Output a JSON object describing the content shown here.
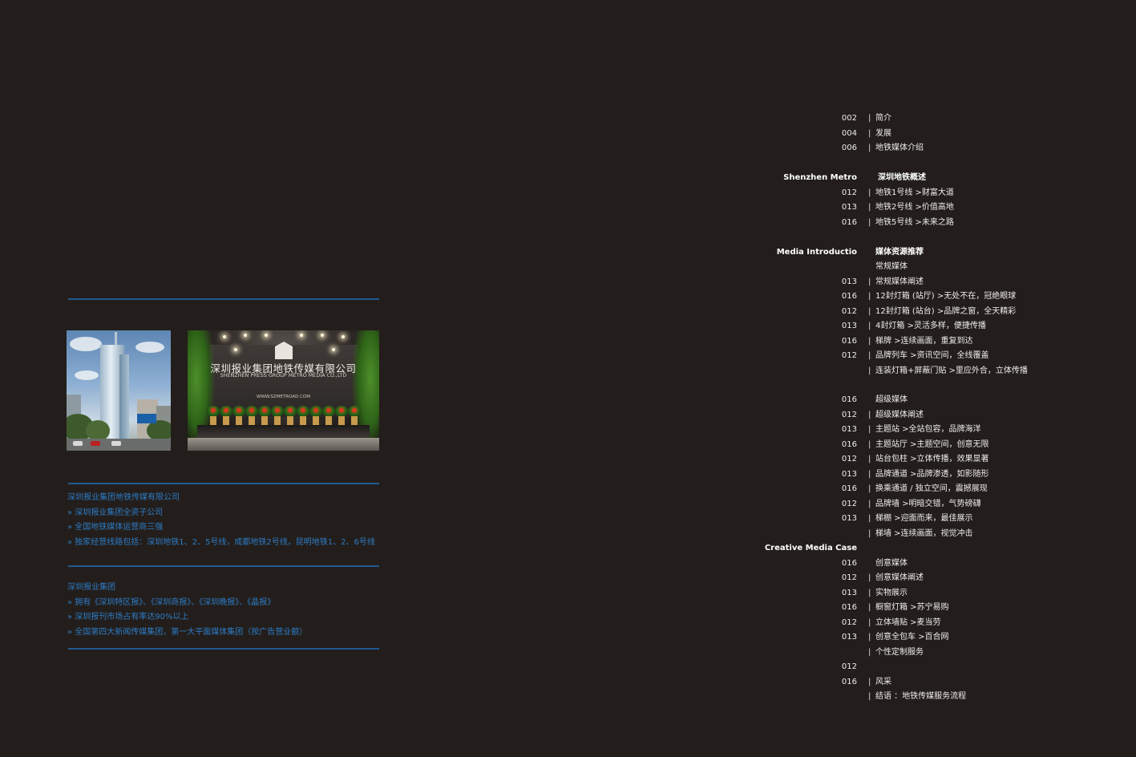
{
  "left_panel": {
    "photo_lobby": {
      "company_cn": "深圳报业集团地铁传媒有限公司",
      "company_en": "SHENZHEN PRESS GROUP METRO MEDIA CO.,LTD",
      "url": "WWW.SZMETROAD.COM"
    },
    "intro_company": [
      "深圳报业集团地铁传媒有限公司",
      "» 深圳报业集团全资子公司",
      "» 全国地铁媒体运营商三强",
      "» 独家经营线路包括：深圳地铁1、2、5号线，成都地铁2号线，昆明地铁1、2、6号线"
    ],
    "intro_group": [
      "深圳报业集团",
      "» 拥有《深圳特区报》、《深圳商报》、《深圳晚报》、《晶报》",
      "» 深圳报刊市场占有率达90%以上",
      "» 全国第四大新闻传媒集团，第一大平面媒体集团（按广告营业额）"
    ]
  },
  "toc": {
    "bar": "|",
    "rows": [
      {
        "num": "002",
        "bar": true,
        "title": "简介"
      },
      {
        "num": "004",
        "bar": true,
        "title": "发展"
      },
      {
        "num": "006",
        "bar": true,
        "title": "地铁媒体介绍"
      },
      {
        "head_en": "Shenzhen Metro",
        "head_cn": "深圳地铁概述"
      },
      {
        "num": "012",
        "bar": true,
        "title": "地铁1号线 >财富大道"
      },
      {
        "num": "013",
        "bar": true,
        "title": "地铁2号线 >价值高地"
      },
      {
        "num": "016",
        "bar": true,
        "title": "地铁5号线 >未来之路"
      },
      {
        "head_en": "Media Introductio",
        "head_cn": "媒体资源推荐"
      },
      {
        "num": "",
        "bar": false,
        "title": "常规媒体"
      },
      {
        "num": "013",
        "bar": true,
        "title": "常规媒体阐述"
      },
      {
        "num": "016",
        "bar": true,
        "title": "12封灯箱 (站厅)  >无处不在，冠绝眼球"
      },
      {
        "num": "012",
        "bar": true,
        "title": "12封灯箱 (站台)  >品牌之窗，全天精彩"
      },
      {
        "num": "013",
        "bar": true,
        "title": "4封灯箱  >灵活多样，便捷传播"
      },
      {
        "num": "016",
        "bar": true,
        "title": "梯牌  >连续画面，重复到达"
      },
      {
        "num": "012",
        "bar": true,
        "title": "品牌列车  >资讯空间，全线覆盖"
      },
      {
        "num": "",
        "bar": true,
        "title": "连装灯箱+屏蔽门贴  >里应外合，立体传播"
      },
      {
        "num": "016",
        "bar": false,
        "title": "超级媒体"
      },
      {
        "num": "012",
        "bar": true,
        "title": "超级媒体阐述"
      },
      {
        "num": "013",
        "bar": true,
        "title": "主题站  >全站包容，品牌海洋"
      },
      {
        "num": "016",
        "bar": true,
        "title": "主题站厅  >主题空间，创意无限"
      },
      {
        "num": "012",
        "bar": true,
        "title": "站台包柱   >立体传播，效果显著"
      },
      {
        "num": "013",
        "bar": true,
        "title": "品牌通道  >品牌渗透，如影随形"
      },
      {
        "num": "016",
        "bar": true,
        "title": "换乘通道 / 独立空间，震撼展现"
      },
      {
        "num": "012",
        "bar": true,
        "title": "品牌墙  >明暗交错，气势磅礴"
      },
      {
        "num": "013",
        "bar": true,
        "title": "梯棚  >迎面而来，最佳展示"
      },
      {
        "num": "",
        "bar": true,
        "title": "梯墙  >连续画面，视觉冲击"
      },
      {
        "head_en": "Creative Media Case",
        "head_cn": ""
      },
      {
        "num": "016",
        "bar": false,
        "title": "创意媒体"
      },
      {
        "num": "012",
        "bar": true,
        "title": "创意媒体阐述"
      },
      {
        "num": "013",
        "bar": true,
        "title": "实物展示"
      },
      {
        "num": "016",
        "bar": true,
        "title": "橱窗灯箱  >苏宁易购"
      },
      {
        "num": "012",
        "bar": true,
        "title": "立体墙贴  >麦当劳"
      },
      {
        "num": "013",
        "bar": true,
        "title": "创意全包车  >百合网"
      },
      {
        "num": "",
        "bar": true,
        "title": "个性定制服务"
      },
      {
        "num": "012",
        "bar": false,
        "title": ""
      },
      {
        "num": "016",
        "bar": true,
        "title": "风采"
      },
      {
        "num": "",
        "bar": true,
        "title": "结语 ：地铁传媒服务流程"
      }
    ]
  }
}
